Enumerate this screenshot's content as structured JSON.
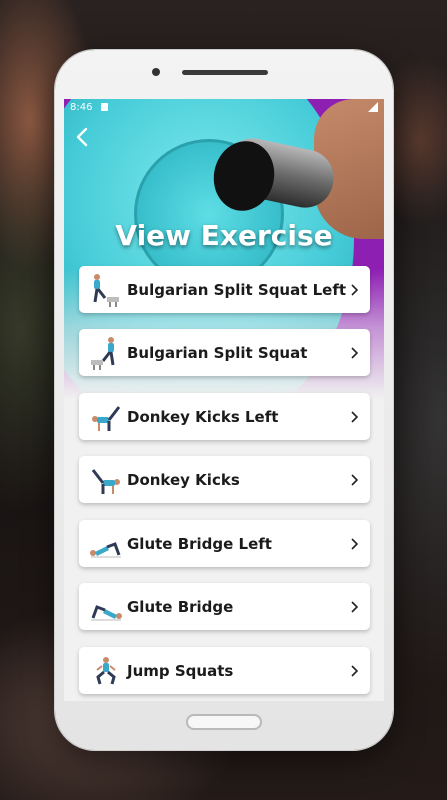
{
  "status_bar": {
    "time": "8:46"
  },
  "header": {
    "title": "View Exercise"
  },
  "exercises": [
    {
      "label": "Bulgarian Split Squat Left",
      "icon": "bulgarian-split-squat-icon"
    },
    {
      "label": "Bulgarian Split Squat",
      "icon": "bulgarian-split-squat-icon"
    },
    {
      "label": "Donkey Kicks Left",
      "icon": "donkey-kicks-icon"
    },
    {
      "label": "Donkey Kicks",
      "icon": "donkey-kicks-icon"
    },
    {
      "label": "Glute Bridge Left",
      "icon": "glute-bridge-icon"
    },
    {
      "label": "Glute Bridge",
      "icon": "glute-bridge-icon"
    },
    {
      "label": "Jump Squats",
      "icon": "jump-squats-icon"
    }
  ],
  "colors": {
    "hero_purple": "#8e1fb3",
    "plate_cyan": "#46ccd8",
    "card_bg": "#ffffff",
    "text": "#1b1b1b"
  }
}
